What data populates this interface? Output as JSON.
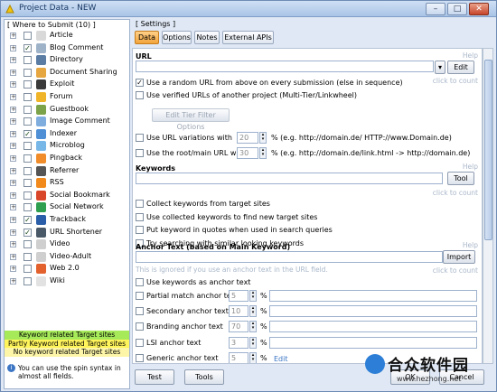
{
  "window": {
    "title": "Project Data - NEW"
  },
  "left": {
    "title": "[ Where to Submit  (10) ]",
    "items": [
      {
        "label": "Article",
        "checked": false,
        "icon": "article-icon",
        "color": "#d9d9d9"
      },
      {
        "label": "Blog Comment",
        "checked": true,
        "icon": "blog-comment-icon",
        "color": "#9fb3c8"
      },
      {
        "label": "Directory",
        "checked": false,
        "icon": "directory-icon",
        "color": "#5b7ca3"
      },
      {
        "label": "Document Sharing",
        "checked": false,
        "icon": "document-sharing-icon",
        "color": "#e6a640"
      },
      {
        "label": "Exploit",
        "checked": false,
        "icon": "exploit-icon",
        "color": "#3a3a3a"
      },
      {
        "label": "Forum",
        "checked": false,
        "icon": "forum-icon",
        "color": "#f0b429"
      },
      {
        "label": "Guestbook",
        "checked": false,
        "icon": "guestbook-icon",
        "color": "#7da34a"
      },
      {
        "label": "Image Comment",
        "checked": false,
        "icon": "image-comment-icon",
        "color": "#7faede"
      },
      {
        "label": "Indexer",
        "checked": true,
        "icon": "indexer-icon",
        "color": "#4e8fd6"
      },
      {
        "label": "Microblog",
        "checked": false,
        "icon": "microblog-icon",
        "color": "#76b7e8"
      },
      {
        "label": "Pingback",
        "checked": false,
        "icon": "pingback-icon",
        "color": "#f08c2a"
      },
      {
        "label": "Referrer",
        "checked": false,
        "icon": "referrer-icon",
        "color": "#555555"
      },
      {
        "label": "RSS",
        "checked": false,
        "icon": "rss-icon",
        "color": "#f28a1b"
      },
      {
        "label": "Social Bookmark",
        "checked": false,
        "icon": "social-bookmark-icon",
        "color": "#d9472b"
      },
      {
        "label": "Social Network",
        "checked": false,
        "icon": "social-network-icon",
        "color": "#2f9e4f"
      },
      {
        "label": "Trackback",
        "checked": true,
        "icon": "trackback-icon",
        "color": "#2a5ea8"
      },
      {
        "label": "URL Shortener",
        "checked": true,
        "icon": "url-shortener-icon",
        "color": "#4a5968"
      },
      {
        "label": "Video",
        "checked": false,
        "icon": "video-icon",
        "color": "#cfcfcf"
      },
      {
        "label": "Video-Adult",
        "checked": false,
        "icon": "video-adult-icon",
        "color": "#cfcfcf"
      },
      {
        "label": "Web 2.0",
        "checked": false,
        "icon": "web20-icon",
        "color": "#e3612d"
      },
      {
        "label": "Wiki",
        "checked": false,
        "icon": "wiki-icon",
        "color": "#e2e2e2"
      }
    ],
    "legend": [
      {
        "label": "Keyword related Target sites",
        "color": "#a6ea5a"
      },
      {
        "label": "Partly Keyword related Target sites",
        "color": "#fff45a"
      },
      {
        "label": "No keyword related Target sites",
        "color": "#fdf6a8"
      }
    ],
    "spin_note": "You can use the spin syntax in almost all fields."
  },
  "settings": {
    "title": "[ Settings ]",
    "tabs": [
      "Data",
      "Options",
      "Notes",
      "External APIs"
    ],
    "active_tab": "Data"
  },
  "url_section": {
    "title": "URL",
    "help": "Help",
    "edit_label": "Edit",
    "click_hint": "click to count",
    "cb_random": "Use a random URL from above on every submission (else in sequence)",
    "cb_random_checked": true,
    "cb_verified": "Use verified URLs of another project (Multi-Tier/Linkwheel)",
    "cb_verified_checked": false,
    "edit_tier_label": "Edit Tier Filter Options",
    "cb_variations": "Use URL variations with",
    "variations_value": "20",
    "variations_desc": "% (e.g. http://domain.de/ HTTP://www.Domain.de)",
    "cb_root": "Use the root/main URL with",
    "root_value": "30",
    "root_desc": "% (e.g. http://domain.de/link.html -> http://domain.de)"
  },
  "keywords_section": {
    "title": "Keywords",
    "help": "Help",
    "tool_label": "Tool",
    "click_hint": "click to count",
    "options": [
      {
        "label": "Collect keywords from target sites",
        "checked": false
      },
      {
        "label": "Use collected keywords to find new target sites",
        "checked": false
      },
      {
        "label": "Put keyword in quotes when used in search queries",
        "checked": false
      },
      {
        "label": "Try searching with similar looking keywords",
        "checked": false
      }
    ]
  },
  "anchor_section": {
    "title": "Anchor Text (based on Main Keyword)",
    "help": "Help",
    "import_label": "Import",
    "ignored_note": "This is ignored if you use an anchor text in the URL field.",
    "click_hint": "click to count",
    "cb_keywords": "Use keywords as anchor text",
    "rows": [
      {
        "label": "Partial match anchor text",
        "value": "5"
      },
      {
        "label": "Secondary anchor text",
        "value": "10"
      },
      {
        "label": "Branding anchor text",
        "value": "70"
      },
      {
        "label": "LSI anchor text",
        "value": "3"
      },
      {
        "label": "Generic anchor text",
        "value": "5"
      }
    ],
    "edit_link": "Edit"
  },
  "bottom": {
    "test_label": "Test",
    "tools_label": "Tools",
    "ok_label": "OK",
    "cancel_label": "Cancel"
  },
  "watermark": {
    "text": "合众软件园",
    "url": "www.hezhong.net"
  }
}
